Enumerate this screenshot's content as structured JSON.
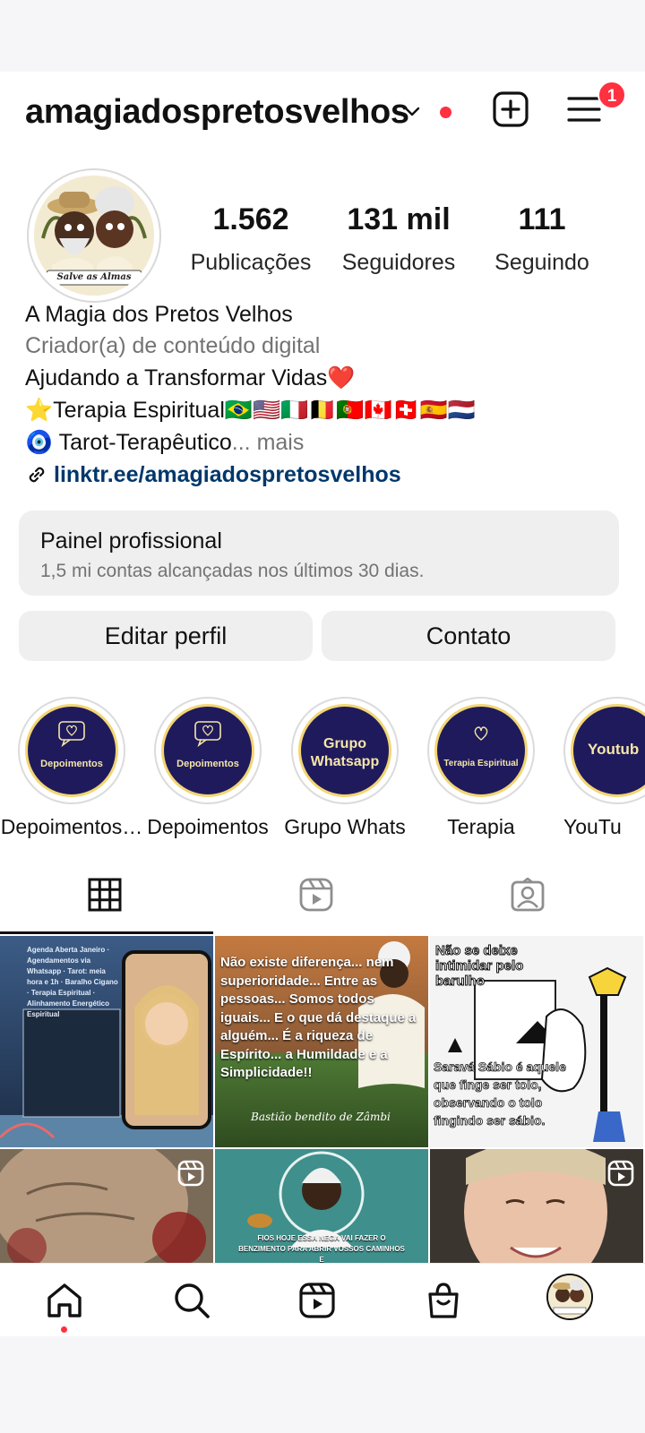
{
  "header": {
    "username": "amagiadospretosvelhos",
    "notification_count": "1"
  },
  "profile": {
    "avatar_caption": "Salve as Almas",
    "stats": [
      {
        "value": "1.562",
        "label": "Publicações"
      },
      {
        "value": "131 mil",
        "label": "Seguidores"
      },
      {
        "value": "111",
        "label": "Seguindo"
      }
    ],
    "name": "A Magia dos Pretos Velhos",
    "category": "Criador(a) de conteúdo digital",
    "bio_line1": "Ajudando a Transformar Vidas❤️",
    "bio_line2": "⭐Terapia Espiritual🇧🇷🇺🇸🇮🇹🇧🇪🇵🇹🇨🇦🇨🇭🇪🇸🇳🇱",
    "bio_line3": "🧿 Tarot-Terapêutico",
    "bio_more": "... mais",
    "link": "linktr.ee/amagiadospretosvelhos"
  },
  "panel": {
    "title": "Painel profissional",
    "subtitle": "1,5 mi contas alcançadas nos últimos 30 dias."
  },
  "actions": {
    "edit_label": "Editar perfil",
    "contact_label": "Contato"
  },
  "highlights": [
    {
      "cover_text": "Depoimentos",
      "label": "Depoimentos…"
    },
    {
      "cover_text": "Depoimentos",
      "label": "Depoimentos"
    },
    {
      "cover_text": "Grupo Whatsapp",
      "label": "Grupo Whats"
    },
    {
      "cover_text": "Terapia Espiritual",
      "label": "Terapia"
    },
    {
      "cover_text": "Youtub",
      "label": "YouTu"
    }
  ],
  "posts": [
    {
      "text": "Agenda Aberta Janeiro · Agendamentos via Whatsapp · Tarot: meia hora e 1h · Baralho Cigano · Terapia Espiritual · Alinhamento Energético Espiritual",
      "reel": false
    },
    {
      "text": "Não existe diferença... nem superioridade... Entre as pessoas... Somos todos iguais... E o que dá destaque a alguém... É a riqueza de Espírito... a Humildade e a Simplicidade!!",
      "signature": "Bastião bendito de Zâmbi",
      "reel": false
    },
    {
      "text_top": "Não se deixe intimidar pelo barulho",
      "text_bottom": "Saravá Sábio é aquele que finge ser tolo, observando o tolo fingindo ser sábio.",
      "reel": false
    },
    {
      "text": "",
      "reel": true
    },
    {
      "text": "FIOS HOJE ESSA NEGA VAI FAZER O BENZIMENTO PARA ABRIR VOSSOS CAMINHOS E",
      "reel": false
    },
    {
      "text": "",
      "reel": true
    }
  ],
  "colors": {
    "accent_red": "#ff3040",
    "link_blue": "#00376b",
    "highlight_disc": "#1f1a5c",
    "highlight_border": "#f2d674"
  }
}
